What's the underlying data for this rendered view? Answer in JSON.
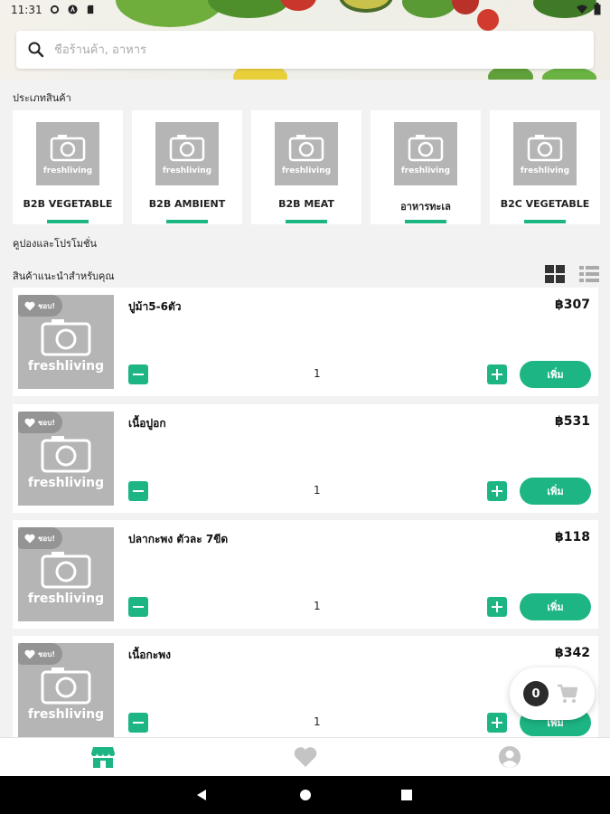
{
  "status_bar": {
    "time": "11:31"
  },
  "search": {
    "placeholder": "ชื่อร้านค้า, อาหาร"
  },
  "categories": {
    "title": "ประเภทสินค้า",
    "items": [
      {
        "name": "B2B VEGETABLE"
      },
      {
        "name": "B2B AMBIENT"
      },
      {
        "name": "B2B MEAT"
      },
      {
        "name": "อาหารทะเล"
      },
      {
        "name": "B2C VEGETABLE"
      }
    ],
    "thumb_brand": "freshliving"
  },
  "coupons": {
    "title": "คูปองและโปรโมชั่น"
  },
  "recommended": {
    "title": "สินค้าแนะนำสำหรับคุณ",
    "fav_label": "ชอบ!",
    "add_label": "เพิ่ม",
    "products": [
      {
        "name": "ปูม้า5-6ตัว",
        "price": "฿307",
        "qty": "1"
      },
      {
        "name": "เนื้อปูอก",
        "price": "฿531",
        "qty": "1"
      },
      {
        "name": "ปลากะพง ตัวละ 7ขีด",
        "price": "฿118",
        "qty": "1"
      },
      {
        "name": "เนื้อกะพง",
        "price": "฿342",
        "qty": "1"
      }
    ]
  },
  "cart": {
    "count": "0"
  },
  "colors": {
    "accent": "#1db584",
    "placeholder_gray": "#b5b5b5"
  },
  "icons": [
    "search-icon",
    "camera-icon",
    "heart-icon",
    "grid-view-icon",
    "list-view-icon",
    "cart-icon",
    "store-icon",
    "favorites-icon",
    "profile-icon"
  ]
}
